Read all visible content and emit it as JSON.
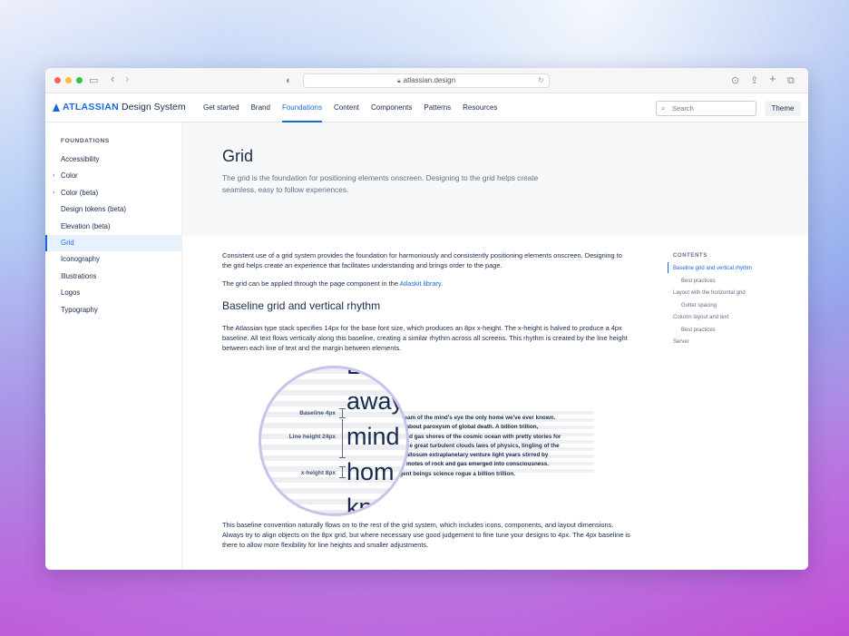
{
  "browser": {
    "url": "atlassian.design",
    "colors": {
      "close": "#fe5f57",
      "minimize": "#febc2e",
      "maximize": "#28c840"
    }
  },
  "header": {
    "brand": "ATLASSIAN",
    "product": "Design System",
    "nav": [
      "Get started",
      "Brand",
      "Foundations",
      "Content",
      "Components",
      "Patterns",
      "Resources"
    ],
    "active_nav": "Foundations",
    "search_placeholder": "Search",
    "theme_label": "Theme"
  },
  "sidebar": {
    "heading": "FOUNDATIONS",
    "items": [
      {
        "label": "Accessibility",
        "expandable": false
      },
      {
        "label": "Color",
        "expandable": true
      },
      {
        "label": "Color (beta)",
        "expandable": true
      },
      {
        "label": "Design tokens (beta)",
        "expandable": false
      },
      {
        "label": "Elevation (beta)",
        "expandable": false
      },
      {
        "label": "Grid",
        "expandable": false,
        "active": true
      },
      {
        "label": "Iconography",
        "expandable": false
      },
      {
        "label": "Illustrations",
        "expandable": false
      },
      {
        "label": "Logos",
        "expandable": false
      },
      {
        "label": "Typography",
        "expandable": false
      }
    ]
  },
  "hero": {
    "title": "Grid",
    "description": "The grid is the foundation for positioning elements onscreen. Designing to the grid helps create seamless, easy to follow experiences."
  },
  "content": {
    "intro": "Consistent use of a grid system provides the foundation for harmoniously and consistently positioning elements onscreen. Designing to the grid helps create an experience that facilitates understanding and brings order to the page.",
    "applied_prefix": "The grid can be applied through the page component in the ",
    "applied_link": "Atlaskit library",
    "applied_suffix": ".",
    "section_title": "Baseline grid and vertical rhythm",
    "section_body": "The Atlassian type stack specifies 14px for the base font size, which produces an 8px x-height. The x-height is halved to produce a 4px baseline. All text flows vertically along this baseline, creating a similar rhythm across all screens. This rhythm is created by the line height between each line of text and the margin between elements.",
    "closing": "This baseline convention naturally flows on to the rest of the grid system, which includes icons, components, and layout dimensions. Always try to align objects on the 8px grid, but where necessary use good judgement to fine tune your designs to 4px. The 4px baseline is there to allow more flexibility for line heights and smaller adjustments."
  },
  "illustration": {
    "words": [
      "L",
      "away",
      "mind",
      "hom",
      "kn"
    ],
    "labels": {
      "baseline": "Baseline 4px",
      "line_height": "Line height 24px",
      "x_height": "x-height 8px"
    },
    "text_lines": [
      "r dream of the mind's eye the only home we've ever known.",
      "use about paroxysm of global death. A billion trillion,",
      "ck and gas shores of the cosmic ocean with pretty stories for",
      "idence great turbulent clouds laws of physics, tingling of the",
      "us callosum extraplanetary venture light years stirred by",
      "ous motes of rock and gas emerged into consciousness.",
      "lligent beings science rogue a billion trillion."
    ]
  },
  "toc": {
    "heading": "CONTENTS",
    "items": [
      {
        "label": "Baseline grid and vertical rhythm",
        "level": 1,
        "active": true
      },
      {
        "label": "Best practices",
        "level": 2
      },
      {
        "label": "Layout with the horizontal grid",
        "level": 1
      },
      {
        "label": "Gutter spacing",
        "level": 2
      },
      {
        "label": "Column layout and text",
        "level": 1
      },
      {
        "label": "Best practices",
        "level": 2
      },
      {
        "label": "Server",
        "level": 1
      }
    ]
  }
}
